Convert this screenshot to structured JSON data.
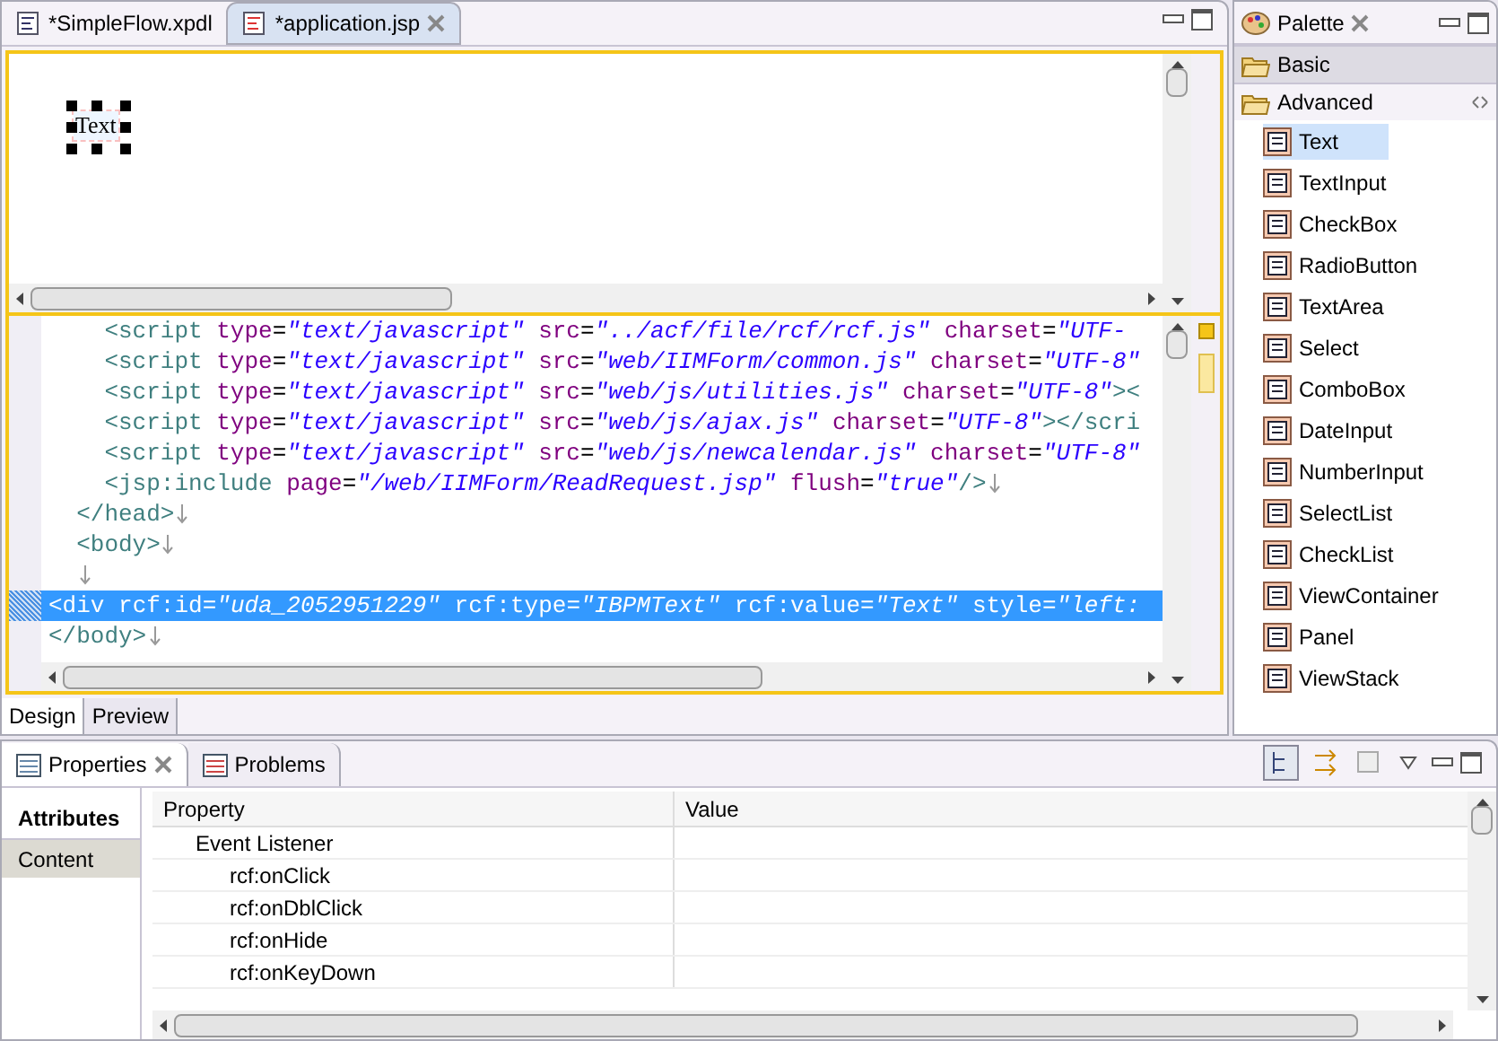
{
  "editor_tabs": [
    {
      "label": "*SimpleFlow.xpdl",
      "selected": false
    },
    {
      "label": "*application.jsp",
      "selected": true
    }
  ],
  "design_canvas": {
    "element": {
      "text": "Text",
      "selected": true
    }
  },
  "source_lines": [
    {
      "selected": false,
      "line_end": false,
      "tokens": [
        {
          "kind": "tag",
          "text": "    <script"
        },
        {
          "kind": "attr",
          "text": " type"
        },
        {
          "kind": "punct",
          "text": "="
        },
        {
          "kind": "value",
          "text": "\"text/javascript\""
        },
        {
          "kind": "attr",
          "text": " src"
        },
        {
          "kind": "punct",
          "text": "="
        },
        {
          "kind": "value",
          "text": "\"../acf/file/rcf/rcf.js\""
        },
        {
          "kind": "attr",
          "text": " charset"
        },
        {
          "kind": "punct",
          "text": "="
        },
        {
          "kind": "value",
          "text": "\"UTF-"
        }
      ]
    },
    {
      "selected": false,
      "line_end": false,
      "tokens": [
        {
          "kind": "tag",
          "text": "    <script"
        },
        {
          "kind": "attr",
          "text": " type"
        },
        {
          "kind": "punct",
          "text": "="
        },
        {
          "kind": "value",
          "text": "\"text/javascript\""
        },
        {
          "kind": "attr",
          "text": " src"
        },
        {
          "kind": "punct",
          "text": "="
        },
        {
          "kind": "value",
          "text": "\"web/IIMForm/common.js\""
        },
        {
          "kind": "attr",
          "text": " charset"
        },
        {
          "kind": "punct",
          "text": "="
        },
        {
          "kind": "value",
          "text": "\"UTF-8\""
        }
      ]
    },
    {
      "selected": false,
      "line_end": false,
      "tokens": [
        {
          "kind": "tag",
          "text": "    <script"
        },
        {
          "kind": "attr",
          "text": " type"
        },
        {
          "kind": "punct",
          "text": "="
        },
        {
          "kind": "value",
          "text": "\"text/javascript\""
        },
        {
          "kind": "attr",
          "text": " src"
        },
        {
          "kind": "punct",
          "text": "="
        },
        {
          "kind": "value",
          "text": "\"web/js/utilities.js\""
        },
        {
          "kind": "attr",
          "text": " charset"
        },
        {
          "kind": "punct",
          "text": "="
        },
        {
          "kind": "value",
          "text": "\"UTF-8\""
        },
        {
          "kind": "tag",
          "text": "><"
        }
      ]
    },
    {
      "selected": false,
      "line_end": false,
      "tokens": [
        {
          "kind": "tag",
          "text": "    <script"
        },
        {
          "kind": "attr",
          "text": " type"
        },
        {
          "kind": "punct",
          "text": "="
        },
        {
          "kind": "value",
          "text": "\"text/javascript\""
        },
        {
          "kind": "attr",
          "text": " src"
        },
        {
          "kind": "punct",
          "text": "="
        },
        {
          "kind": "value",
          "text": "\"web/js/ajax.js\""
        },
        {
          "kind": "attr",
          "text": " charset"
        },
        {
          "kind": "punct",
          "text": "="
        },
        {
          "kind": "value",
          "text": "\"UTF-8\""
        },
        {
          "kind": "tag",
          "text": "></scri"
        }
      ]
    },
    {
      "selected": false,
      "line_end": false,
      "tokens": [
        {
          "kind": "tag",
          "text": "    <script"
        },
        {
          "kind": "attr",
          "text": " type"
        },
        {
          "kind": "punct",
          "text": "="
        },
        {
          "kind": "value",
          "text": "\"text/javascript\""
        },
        {
          "kind": "attr",
          "text": " src"
        },
        {
          "kind": "punct",
          "text": "="
        },
        {
          "kind": "value",
          "text": "\"web/js/newcalendar.js\""
        },
        {
          "kind": "attr",
          "text": " charset"
        },
        {
          "kind": "punct",
          "text": "="
        },
        {
          "kind": "value",
          "text": "\"UTF-8\""
        }
      ]
    },
    {
      "selected": false,
      "line_end": true,
      "tokens": [
        {
          "kind": "tag",
          "text": "    <jsp:include"
        },
        {
          "kind": "attr",
          "text": " page"
        },
        {
          "kind": "punct",
          "text": "="
        },
        {
          "kind": "value",
          "text": "\"/web/IIMForm/ReadRequest.jsp\""
        },
        {
          "kind": "attr",
          "text": " flush"
        },
        {
          "kind": "punct",
          "text": "="
        },
        {
          "kind": "value",
          "text": "\"true\""
        },
        {
          "kind": "tag",
          "text": "/>"
        }
      ]
    },
    {
      "selected": false,
      "line_end": true,
      "tokens": [
        {
          "kind": "tag",
          "text": "  </head>"
        }
      ]
    },
    {
      "selected": false,
      "line_end": true,
      "tokens": [
        {
          "kind": "tag",
          "text": "  <body>"
        }
      ]
    },
    {
      "selected": false,
      "line_end": true
    },
    {
      "selected": true,
      "line_end": false,
      "tokens": [
        {
          "kind": "tag",
          "text": "<div"
        },
        {
          "kind": "attr",
          "text": " rcf:id"
        },
        {
          "kind": "punct",
          "text": "="
        },
        {
          "kind": "value",
          "text": "\"uda_2052951229\""
        },
        {
          "kind": "attr",
          "text": " rcf:type"
        },
        {
          "kind": "punct",
          "text": "="
        },
        {
          "kind": "value",
          "text": "\"IBPMText\""
        },
        {
          "kind": "attr",
          "text": " rcf:value"
        },
        {
          "kind": "punct",
          "text": "="
        },
        {
          "kind": "value",
          "text": "\"Text\""
        },
        {
          "kind": "attr",
          "text": " style"
        },
        {
          "kind": "punct",
          "text": "="
        },
        {
          "kind": "value",
          "text": "\"left:"
        }
      ]
    },
    {
      "selected": false,
      "line_end": true,
      "tokens": [
        {
          "kind": "tag",
          "text": "</body>"
        }
      ]
    }
  ],
  "page_tabs": [
    {
      "label": "Design",
      "selected": true
    },
    {
      "label": "Preview",
      "selected": false
    }
  ],
  "palette": {
    "title": "Palette",
    "drawers": [
      {
        "label": "Basic",
        "expanded": false
      },
      {
        "label": "Advanced",
        "expanded": true,
        "items": [
          {
            "label": "Text",
            "selected": true
          },
          {
            "label": "TextInput",
            "selected": false
          },
          {
            "label": "CheckBox",
            "selected": false
          },
          {
            "label": "RadioButton",
            "selected": false
          },
          {
            "label": "TextArea",
            "selected": false
          },
          {
            "label": "Select",
            "selected": false
          },
          {
            "label": "ComboBox",
            "selected": false
          },
          {
            "label": "DateInput",
            "selected": false
          },
          {
            "label": "NumberInput",
            "selected": false
          },
          {
            "label": "SelectList",
            "selected": false
          },
          {
            "label": "CheckList",
            "selected": false
          },
          {
            "label": "ViewContainer",
            "selected": false
          },
          {
            "label": "Panel",
            "selected": false
          },
          {
            "label": "ViewStack",
            "selected": false
          }
        ]
      }
    ]
  },
  "bottom_tabs": [
    {
      "label": "Properties",
      "selected": true,
      "closable": true
    },
    {
      "label": "Problems",
      "selected": false,
      "closable": false
    }
  ],
  "property_sections": [
    {
      "label": "Attributes",
      "selected": true
    },
    {
      "label": "Content",
      "selected": false
    }
  ],
  "property_table": {
    "columns": [
      "Property",
      "Value"
    ],
    "rows": [
      {
        "property": "Event Listener",
        "children": [
          {
            "property": "rcf:onClick"
          },
          {
            "property": "rcf:onDblClick"
          },
          {
            "property": "rcf:onHide"
          },
          {
            "property": "rcf:onKeyDown"
          }
        ]
      }
    ]
  }
}
